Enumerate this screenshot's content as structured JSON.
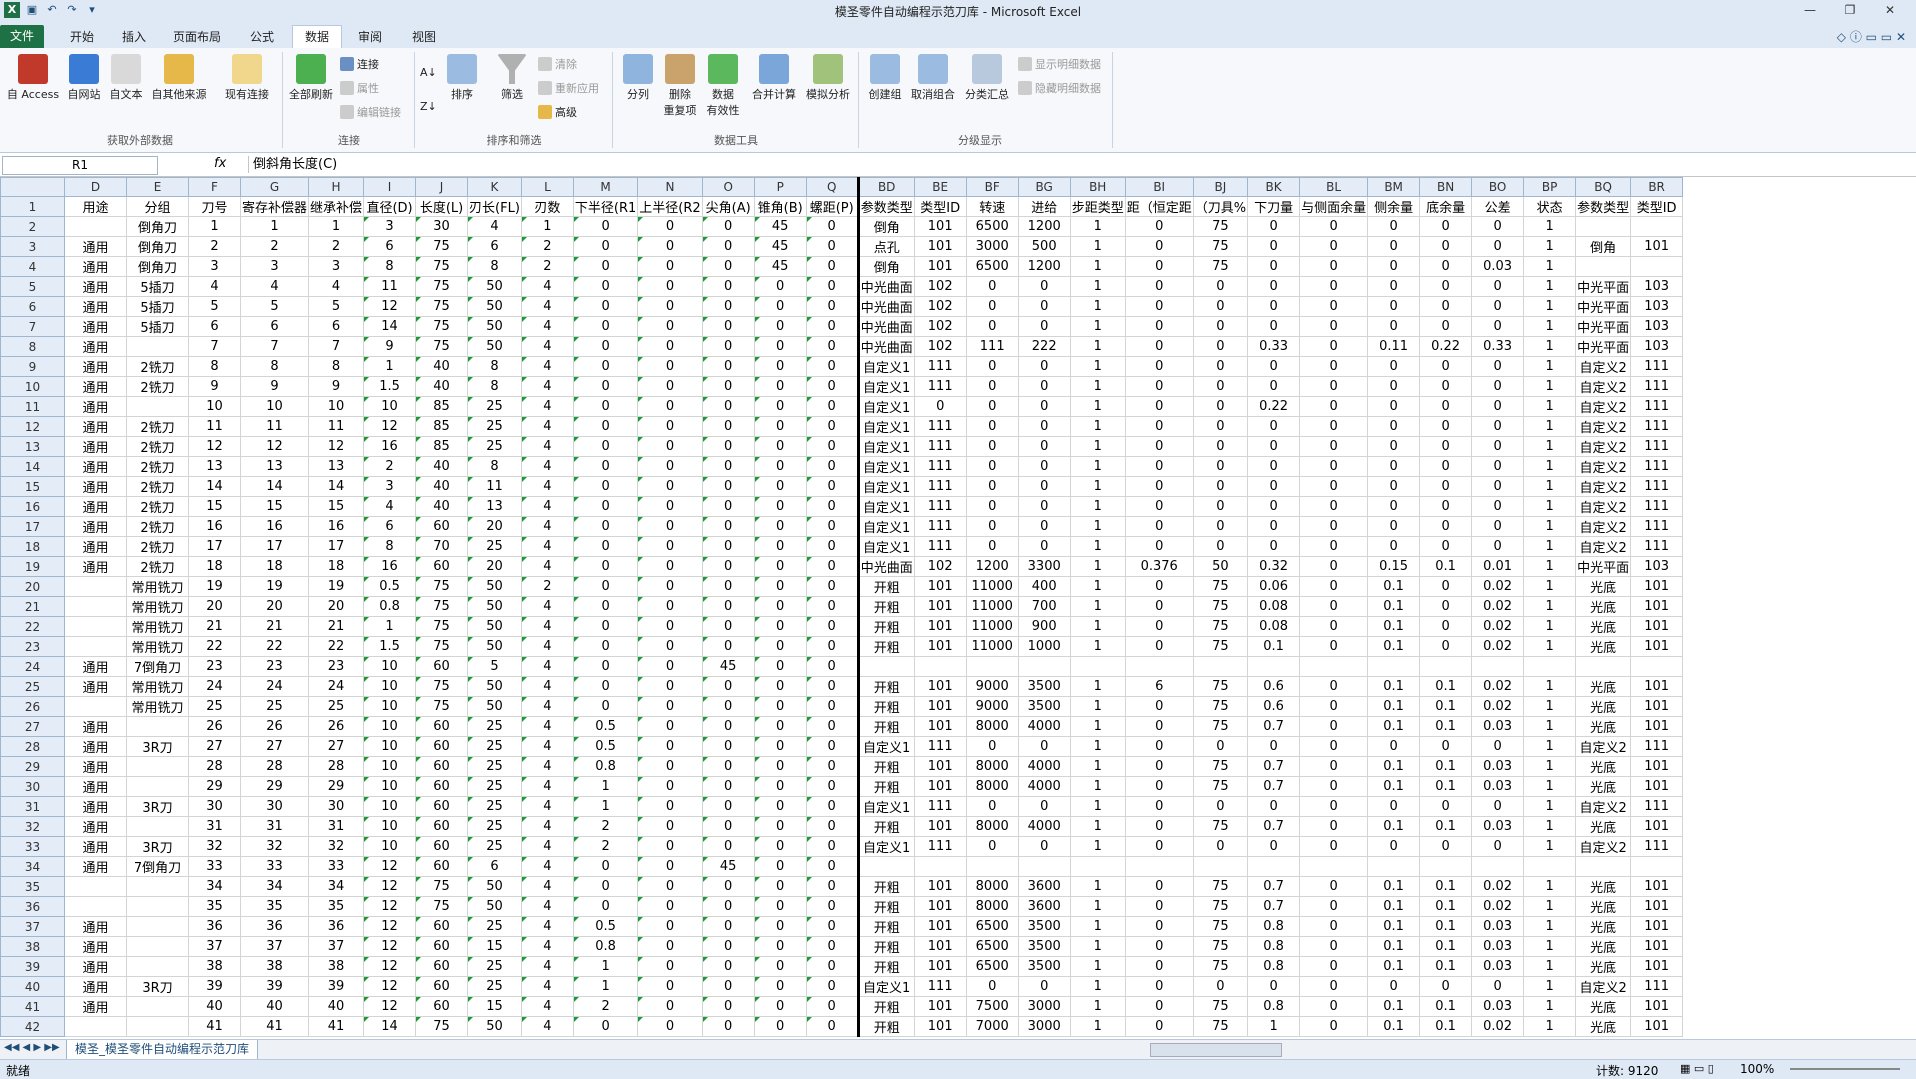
{
  "title": "模圣零件自动编程示范刀库  -  Microsoft Excel",
  "tabs": [
    "文件",
    "开始",
    "插入",
    "页面布局",
    "公式",
    "数据",
    "审阅",
    "视图"
  ],
  "ribbon": {
    "ext_data": [
      "自 Access",
      "自网站",
      "自文本",
      "自其他来源",
      "现有连接"
    ],
    "refresh": "全部刷新",
    "conn": [
      "连接",
      "属性",
      "编辑链接"
    ],
    "sort": "排序",
    "filter": "筛选",
    "filter_small": [
      "清除",
      "重新应用",
      "高级"
    ],
    "tools": [
      "分列",
      "删除\n重复项",
      "数据\n有效性",
      "合并计算",
      "模拟分析"
    ],
    "outline": [
      "创建组",
      "取消组合",
      "分类汇总"
    ],
    "outline_small": [
      "显示明细数据",
      "隐藏明细数据"
    ],
    "groups": [
      "获取外部数据",
      "连接",
      "排序和筛选",
      "数据工具",
      "分级显示"
    ]
  },
  "namebox": "R1",
  "fx": "fx",
  "formula": "倒斜角长度(C)",
  "col_letters": [
    "D",
    "E",
    "F",
    "G",
    "H",
    "I",
    "J",
    "K",
    "L",
    "M",
    "N",
    "O",
    "P",
    "Q",
    "BD",
    "BE",
    "BF",
    "BG",
    "BH",
    "BI",
    "BJ",
    "BK",
    "BL",
    "BM",
    "BN",
    "BO",
    "BP",
    "BQ",
    "BR"
  ],
  "header": [
    "用途",
    "分组",
    "刀号",
    "寄存补偿器",
    "继承补偿",
    "直径(D)",
    "长度(L)",
    "刃长(FL)",
    "刃数",
    "下半径(R1",
    "上半径(R2",
    "尖角(A)",
    "锥角(B)",
    "螺距(P)",
    "参数类型",
    "类型ID",
    "转速",
    "进给",
    "步距类型",
    "距（恒定距",
    "（刀具%",
    "下刀量",
    "与侧面余量",
    "侧余量",
    "底余量",
    "公差",
    "状态",
    "参数类型",
    "类型ID"
  ],
  "rows": [
    [
      "",
      "倒角刀",
      "1",
      "1",
      "1",
      "3",
      "30",
      "4",
      "1",
      "0",
      "0",
      "0",
      "45",
      "0",
      "倒角",
      "101",
      "6500",
      "1200",
      "1",
      "0",
      "75",
      "0",
      "0",
      "0",
      "0",
      "0",
      "1",
      "",
      ""
    ],
    [
      "通用",
      "倒角刀",
      "2",
      "2",
      "2",
      "6",
      "75",
      "6",
      "2",
      "0",
      "0",
      "0",
      "45",
      "0",
      "点孔",
      "101",
      "3000",
      "500",
      "1",
      "0",
      "75",
      "0",
      "0",
      "0",
      "0",
      "0",
      "1",
      "倒角",
      "101"
    ],
    [
      "通用",
      "倒角刀",
      "3",
      "3",
      "3",
      "8",
      "75",
      "8",
      "2",
      "0",
      "0",
      "0",
      "45",
      "0",
      "倒角",
      "101",
      "6500",
      "1200",
      "1",
      "0",
      "75",
      "0",
      "0",
      "0",
      "0",
      "0.03",
      "1",
      "",
      ""
    ],
    [
      "通用",
      "5插刀",
      "4",
      "4",
      "4",
      "11",
      "75",
      "50",
      "4",
      "0",
      "0",
      "0",
      "0",
      "0",
      "中光曲面",
      "102",
      "0",
      "0",
      "1",
      "0",
      "0",
      "0",
      "0",
      "0",
      "0",
      "0",
      "1",
      "中光平面",
      "103"
    ],
    [
      "通用",
      "5插刀",
      "5",
      "5",
      "5",
      "12",
      "75",
      "50",
      "4",
      "0",
      "0",
      "0",
      "0",
      "0",
      "中光曲面",
      "102",
      "0",
      "0",
      "1",
      "0",
      "0",
      "0",
      "0",
      "0",
      "0",
      "0",
      "1",
      "中光平面",
      "103"
    ],
    [
      "通用",
      "5插刀",
      "6",
      "6",
      "6",
      "14",
      "75",
      "50",
      "4",
      "0",
      "0",
      "0",
      "0",
      "0",
      "中光曲面",
      "102",
      "0",
      "0",
      "1",
      "0",
      "0",
      "0",
      "0",
      "0",
      "0",
      "0",
      "1",
      "中光平面",
      "103"
    ],
    [
      "通用",
      "",
      "7",
      "7",
      "7",
      "9",
      "75",
      "50",
      "4",
      "0",
      "0",
      "0",
      "0",
      "0",
      "中光曲面",
      "102",
      "111",
      "222",
      "1",
      "0",
      "0",
      "0.33",
      "0",
      "0.11",
      "0.22",
      "0.33",
      "1",
      "中光平面",
      "103"
    ],
    [
      "通用",
      "2铣刀",
      "8",
      "8",
      "8",
      "1",
      "40",
      "8",
      "4",
      "0",
      "0",
      "0",
      "0",
      "0",
      "自定义1",
      "111",
      "0",
      "0",
      "1",
      "0",
      "0",
      "0",
      "0",
      "0",
      "0",
      "0",
      "1",
      "自定义2",
      "111"
    ],
    [
      "通用",
      "2铣刀",
      "9",
      "9",
      "9",
      "1.5",
      "40",
      "8",
      "4",
      "0",
      "0",
      "0",
      "0",
      "0",
      "自定义1",
      "111",
      "0",
      "0",
      "1",
      "0",
      "0",
      "0",
      "0",
      "0",
      "0",
      "0",
      "1",
      "自定义2",
      "111"
    ],
    [
      "通用",
      "",
      "10",
      "10",
      "10",
      "10",
      "85",
      "25",
      "4",
      "0",
      "0",
      "0",
      "0",
      "0",
      "自定义1",
      "0",
      "0",
      "0",
      "1",
      "0",
      "0",
      "0.22",
      "0",
      "0",
      "0",
      "0",
      "1",
      "自定义2",
      "111"
    ],
    [
      "通用",
      "2铣刀",
      "11",
      "11",
      "11",
      "12",
      "85",
      "25",
      "4",
      "0",
      "0",
      "0",
      "0",
      "0",
      "自定义1",
      "111",
      "0",
      "0",
      "1",
      "0",
      "0",
      "0",
      "0",
      "0",
      "0",
      "0",
      "1",
      "自定义2",
      "111"
    ],
    [
      "通用",
      "2铣刀",
      "12",
      "12",
      "12",
      "16",
      "85",
      "25",
      "4",
      "0",
      "0",
      "0",
      "0",
      "0",
      "自定义1",
      "111",
      "0",
      "0",
      "1",
      "0",
      "0",
      "0",
      "0",
      "0",
      "0",
      "0",
      "1",
      "自定义2",
      "111"
    ],
    [
      "通用",
      "2铣刀",
      "13",
      "13",
      "13",
      "2",
      "40",
      "8",
      "4",
      "0",
      "0",
      "0",
      "0",
      "0",
      "自定义1",
      "111",
      "0",
      "0",
      "1",
      "0",
      "0",
      "0",
      "0",
      "0",
      "0",
      "0",
      "1",
      "自定义2",
      "111"
    ],
    [
      "通用",
      "2铣刀",
      "14",
      "14",
      "14",
      "3",
      "40",
      "11",
      "4",
      "0",
      "0",
      "0",
      "0",
      "0",
      "自定义1",
      "111",
      "0",
      "0",
      "1",
      "0",
      "0",
      "0",
      "0",
      "0",
      "0",
      "0",
      "1",
      "自定义2",
      "111"
    ],
    [
      "通用",
      "2铣刀",
      "15",
      "15",
      "15",
      "4",
      "40",
      "13",
      "4",
      "0",
      "0",
      "0",
      "0",
      "0",
      "自定义1",
      "111",
      "0",
      "0",
      "1",
      "0",
      "0",
      "0",
      "0",
      "0",
      "0",
      "0",
      "1",
      "自定义2",
      "111"
    ],
    [
      "通用",
      "2铣刀",
      "16",
      "16",
      "16",
      "6",
      "60",
      "20",
      "4",
      "0",
      "0",
      "0",
      "0",
      "0",
      "自定义1",
      "111",
      "0",
      "0",
      "1",
      "0",
      "0",
      "0",
      "0",
      "0",
      "0",
      "0",
      "1",
      "自定义2",
      "111"
    ],
    [
      "通用",
      "2铣刀",
      "17",
      "17",
      "17",
      "8",
      "70",
      "25",
      "4",
      "0",
      "0",
      "0",
      "0",
      "0",
      "自定义1",
      "111",
      "0",
      "0",
      "1",
      "0",
      "0",
      "0",
      "0",
      "0",
      "0",
      "0",
      "1",
      "自定义2",
      "111"
    ],
    [
      "通用",
      "2铣刀",
      "18",
      "18",
      "18",
      "16",
      "60",
      "20",
      "4",
      "0",
      "0",
      "0",
      "0",
      "0",
      "中光曲面",
      "102",
      "1200",
      "3300",
      "1",
      "0.376",
      "50",
      "0.32",
      "0",
      "0.15",
      "0.1",
      "0.01",
      "1",
      "中光平面",
      "103"
    ],
    [
      "",
      "常用铣刀",
      "19",
      "19",
      "19",
      "0.5",
      "75",
      "50",
      "2",
      "0",
      "0",
      "0",
      "0",
      "0",
      "开粗",
      "101",
      "11000",
      "400",
      "1",
      "0",
      "75",
      "0.06",
      "0",
      "0.1",
      "0",
      "0.02",
      "1",
      "光底",
      "101"
    ],
    [
      "",
      "常用铣刀",
      "20",
      "20",
      "20",
      "0.8",
      "75",
      "50",
      "4",
      "0",
      "0",
      "0",
      "0",
      "0",
      "开粗",
      "101",
      "11000",
      "700",
      "1",
      "0",
      "75",
      "0.08",
      "0",
      "0.1",
      "0",
      "0.02",
      "1",
      "光底",
      "101"
    ],
    [
      "",
      "常用铣刀",
      "21",
      "21",
      "21",
      "1",
      "75",
      "50",
      "4",
      "0",
      "0",
      "0",
      "0",
      "0",
      "开粗",
      "101",
      "11000",
      "900",
      "1",
      "0",
      "75",
      "0.08",
      "0",
      "0.1",
      "0",
      "0.02",
      "1",
      "光底",
      "101"
    ],
    [
      "",
      "常用铣刀",
      "22",
      "22",
      "22",
      "1.5",
      "75",
      "50",
      "4",
      "0",
      "0",
      "0",
      "0",
      "0",
      "开粗",
      "101",
      "11000",
      "1000",
      "1",
      "0",
      "75",
      "0.1",
      "0",
      "0.1",
      "0",
      "0.02",
      "1",
      "光底",
      "101"
    ],
    [
      "通用",
      "7倒角刀",
      "23",
      "23",
      "23",
      "10",
      "60",
      "5",
      "4",
      "0",
      "0",
      "45",
      "0",
      "0",
      "",
      "",
      "",
      "",
      "",
      "",
      "",
      "",
      "",
      "",
      "",
      "",
      "",
      "",
      ""
    ],
    [
      "通用",
      "常用铣刀",
      "24",
      "24",
      "24",
      "10",
      "75",
      "50",
      "4",
      "0",
      "0",
      "0",
      "0",
      "0",
      "开粗",
      "101",
      "9000",
      "3500",
      "1",
      "6",
      "75",
      "0.6",
      "0",
      "0.1",
      "0.1",
      "0.02",
      "1",
      "光底",
      "101"
    ],
    [
      "",
      "常用铣刀",
      "25",
      "25",
      "25",
      "10",
      "75",
      "50",
      "4",
      "0",
      "0",
      "0",
      "0",
      "0",
      "开粗",
      "101",
      "9000",
      "3500",
      "1",
      "0",
      "75",
      "0.6",
      "0",
      "0.1",
      "0.1",
      "0.02",
      "1",
      "光底",
      "101"
    ],
    [
      "通用",
      "",
      "26",
      "26",
      "26",
      "10",
      "60",
      "25",
      "4",
      "0.5",
      "0",
      "0",
      "0",
      "0",
      "开粗",
      "101",
      "8000",
      "4000",
      "1",
      "0",
      "75",
      "0.7",
      "0",
      "0.1",
      "0.1",
      "0.03",
      "1",
      "光底",
      "101"
    ],
    [
      "通用",
      "3R刀",
      "27",
      "27",
      "27",
      "10",
      "60",
      "25",
      "4",
      "0.5",
      "0",
      "0",
      "0",
      "0",
      "自定义1",
      "111",
      "0",
      "0",
      "1",
      "0",
      "0",
      "0",
      "0",
      "0",
      "0",
      "0",
      "1",
      "自定义2",
      "111"
    ],
    [
      "通用",
      "",
      "28",
      "28",
      "28",
      "10",
      "60",
      "25",
      "4",
      "0.8",
      "0",
      "0",
      "0",
      "0",
      "开粗",
      "101",
      "8000",
      "4000",
      "1",
      "0",
      "75",
      "0.7",
      "0",
      "0.1",
      "0.1",
      "0.03",
      "1",
      "光底",
      "101"
    ],
    [
      "通用",
      "",
      "29",
      "29",
      "29",
      "10",
      "60",
      "25",
      "4",
      "1",
      "0",
      "0",
      "0",
      "0",
      "开粗",
      "101",
      "8000",
      "4000",
      "1",
      "0",
      "75",
      "0.7",
      "0",
      "0.1",
      "0.1",
      "0.03",
      "1",
      "光底",
      "101"
    ],
    [
      "通用",
      "3R刀",
      "30",
      "30",
      "30",
      "10",
      "60",
      "25",
      "4",
      "1",
      "0",
      "0",
      "0",
      "0",
      "自定义1",
      "111",
      "0",
      "0",
      "1",
      "0",
      "0",
      "0",
      "0",
      "0",
      "0",
      "0",
      "1",
      "自定义2",
      "111"
    ],
    [
      "通用",
      "",
      "31",
      "31",
      "31",
      "10",
      "60",
      "25",
      "4",
      "2",
      "0",
      "0",
      "0",
      "0",
      "开粗",
      "101",
      "8000",
      "4000",
      "1",
      "0",
      "75",
      "0.7",
      "0",
      "0.1",
      "0.1",
      "0.03",
      "1",
      "光底",
      "101"
    ],
    [
      "通用",
      "3R刀",
      "32",
      "32",
      "32",
      "10",
      "60",
      "25",
      "4",
      "2",
      "0",
      "0",
      "0",
      "0",
      "自定义1",
      "111",
      "0",
      "0",
      "1",
      "0",
      "0",
      "0",
      "0",
      "0",
      "0",
      "0",
      "1",
      "自定义2",
      "111"
    ],
    [
      "通用",
      "7倒角刀",
      "33",
      "33",
      "33",
      "12",
      "60",
      "6",
      "4",
      "0",
      "0",
      "45",
      "0",
      "0",
      "",
      "",
      "",
      "",
      "",
      "",
      "",
      "",
      "",
      "",
      "",
      "",
      "",
      "",
      ""
    ],
    [
      "",
      "",
      "34",
      "34",
      "34",
      "12",
      "75",
      "50",
      "4",
      "0",
      "0",
      "0",
      "0",
      "0",
      "开粗",
      "101",
      "8000",
      "3600",
      "1",
      "0",
      "75",
      "0.7",
      "0",
      "0.1",
      "0.1",
      "0.02",
      "1",
      "光底",
      "101"
    ],
    [
      "",
      "",
      "35",
      "35",
      "35",
      "12",
      "75",
      "50",
      "4",
      "0",
      "0",
      "0",
      "0",
      "0",
      "开粗",
      "101",
      "8000",
      "3600",
      "1",
      "0",
      "75",
      "0.7",
      "0",
      "0.1",
      "0.1",
      "0.02",
      "1",
      "光底",
      "101"
    ],
    [
      "通用",
      "",
      "36",
      "36",
      "36",
      "12",
      "60",
      "25",
      "4",
      "0.5",
      "0",
      "0",
      "0",
      "0",
      "开粗",
      "101",
      "6500",
      "3500",
      "1",
      "0",
      "75",
      "0.8",
      "0",
      "0.1",
      "0.1",
      "0.03",
      "1",
      "光底",
      "101"
    ],
    [
      "通用",
      "",
      "37",
      "37",
      "37",
      "12",
      "60",
      "15",
      "4",
      "0.8",
      "0",
      "0",
      "0",
      "0",
      "开粗",
      "101",
      "6500",
      "3500",
      "1",
      "0",
      "75",
      "0.8",
      "0",
      "0.1",
      "0.1",
      "0.03",
      "1",
      "光底",
      "101"
    ],
    [
      "通用",
      "",
      "38",
      "38",
      "38",
      "12",
      "60",
      "25",
      "4",
      "1",
      "0",
      "0",
      "0",
      "0",
      "开粗",
      "101",
      "6500",
      "3500",
      "1",
      "0",
      "75",
      "0.8",
      "0",
      "0.1",
      "0.1",
      "0.03",
      "1",
      "光底",
      "101"
    ],
    [
      "通用",
      "3R刀",
      "39",
      "39",
      "39",
      "12",
      "60",
      "25",
      "4",
      "1",
      "0",
      "0",
      "0",
      "0",
      "自定义1",
      "111",
      "0",
      "0",
      "1",
      "0",
      "0",
      "0",
      "0",
      "0",
      "0",
      "0",
      "1",
      "自定义2",
      "111"
    ],
    [
      "通用",
      "",
      "40",
      "40",
      "40",
      "12",
      "60",
      "15",
      "4",
      "2",
      "0",
      "0",
      "0",
      "0",
      "开粗",
      "101",
      "7500",
      "3000",
      "1",
      "0",
      "75",
      "0.8",
      "0",
      "0.1",
      "0.1",
      "0.03",
      "1",
      "光底",
      "101"
    ],
    [
      "",
      "",
      "41",
      "41",
      "41",
      "14",
      "75",
      "50",
      "4",
      "0",
      "0",
      "0",
      "0",
      "0",
      "开粗",
      "101",
      "7000",
      "3000",
      "1",
      "0",
      "75",
      "1",
      "0",
      "0.1",
      "0.1",
      "0.02",
      "1",
      "光底",
      "101"
    ]
  ],
  "sheet_tab": "模圣_模圣零件自动编程示范刀库",
  "status": {
    "ready": "就绪",
    "count": "计数: 9120",
    "zoom": "100%"
  }
}
